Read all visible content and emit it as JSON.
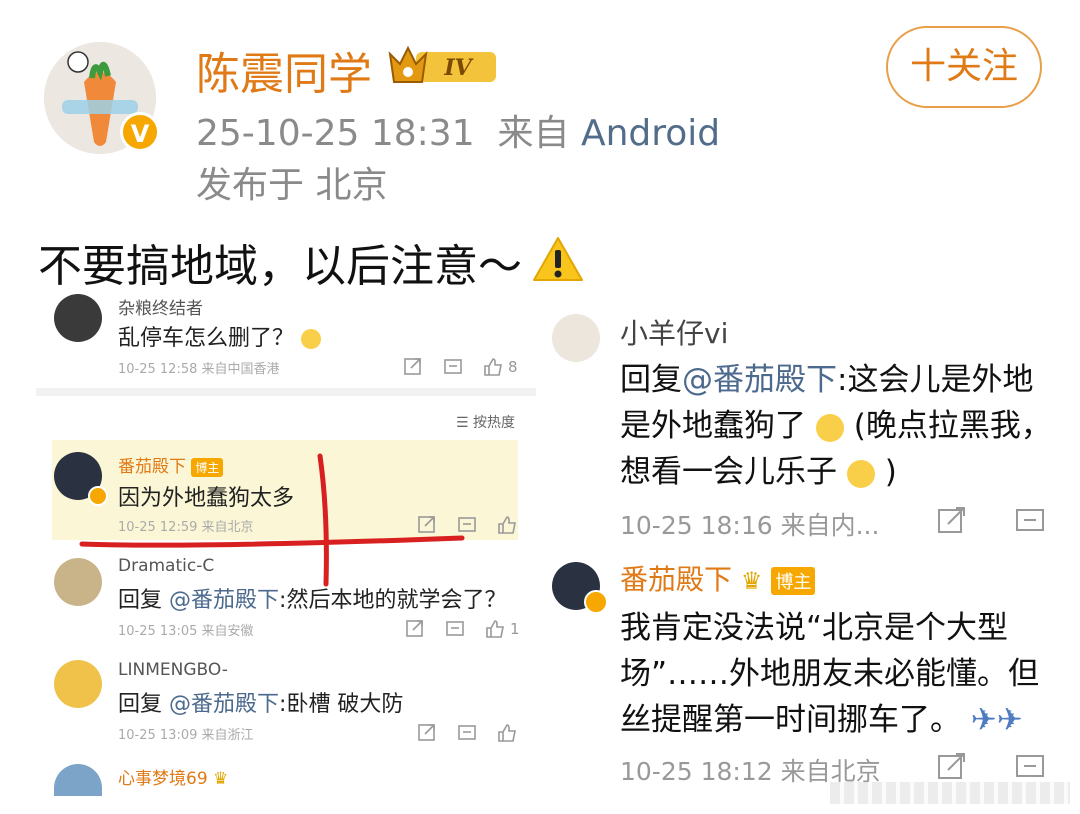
{
  "header": {
    "username": "陈震同学",
    "level": "IV",
    "timestamp": "25-10-25 18:31",
    "source_prefix": "来自",
    "source": "Android",
    "location": "发布于 北京",
    "follow_label": "十关注",
    "verified": "V"
  },
  "post": {
    "text": "不要搞地域，以后注意～"
  },
  "left_shot": {
    "sort_label": "按热度",
    "comments": [
      {
        "name": "杂粮终结者",
        "text": "乱停车怎么删了？",
        "meta": "10-25 12:58  来自中国香港",
        "likes": "8"
      },
      {
        "name": "番茄殿下",
        "badge": "博主",
        "text": "因为外地蠢狗太多",
        "meta": "10-25 12:59  来自北京",
        "likes": ""
      },
      {
        "name": "Dramatic-C",
        "reply": "回复",
        "at": "@番茄殿下",
        "text": ":然后本地的就学会了？",
        "meta": "10-25 13:05  来自安徽",
        "likes": "1"
      },
      {
        "name": "LINMENGBO-",
        "reply": "回复",
        "at": "@番茄殿下",
        "text": ":卧槽 破大防",
        "meta": "10-25 13:09  来自浙江",
        "likes": ""
      },
      {
        "name": "心事梦境69"
      }
    ]
  },
  "right_shot": {
    "comments": [
      {
        "name": "小羊仔vi",
        "line1_prefix": "回复",
        "line1_at": "@番茄殿下",
        "line1_rest": ":这会儿是外地",
        "line2": "是外地蠢狗了",
        "line2_rest": "(晚点拉黑我，",
        "line3": "想看一会儿乐子",
        "line3_rest": ")",
        "meta": "10-25 18:16  来自内..."
      },
      {
        "name": "番茄殿下",
        "badge": "博主",
        "line1": "我肯定没法说“北京是个大型",
        "line2": "场”……外地朋友未必能懂。但",
        "line3": "丝提醒第一时间挪车了。",
        "meta": "10-25 18:12  来自北京"
      }
    ]
  },
  "colors": {
    "username": "#e07a16",
    "link": "#4b6a8d",
    "badge": "#f6a700",
    "highlight": "#fbf7d6",
    "redline": "#d92020"
  }
}
